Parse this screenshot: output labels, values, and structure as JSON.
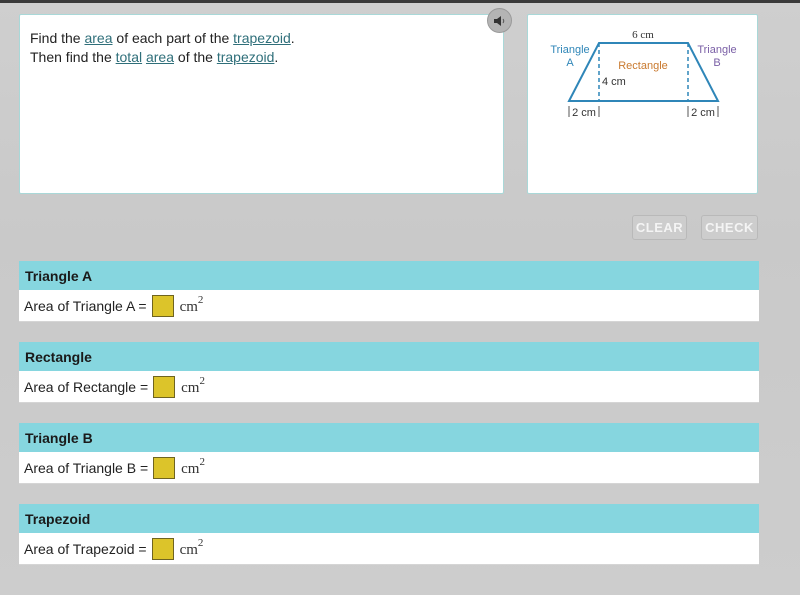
{
  "prompt": {
    "line1": {
      "t1": "Find the ",
      "link1": "area",
      "t2": " of each part of the ",
      "link2": "trapezoid",
      "t3": "."
    },
    "line2": {
      "t1": "Then find the ",
      "link1": "total",
      "t2": " ",
      "link2": "area",
      "t3": " of the ",
      "link3": "trapezoid",
      "t4": "."
    }
  },
  "audio": {
    "icon": "speaker-icon"
  },
  "figure": {
    "top_label": "6 cm",
    "triangle_a": [
      "Triangle",
      "A"
    ],
    "triangle_b": [
      "Triangle",
      "B"
    ],
    "rectangle": "Rectangle",
    "height": "4 cm",
    "left_base": "2 cm",
    "right_base": "2 cm",
    "colors": {
      "outline": "#2f86b8",
      "triangle_a": "#2f86b8",
      "triangle_b": "#7a5fa6",
      "rectangle": "#c97a2f"
    }
  },
  "buttons": {
    "clear": "CLEAR",
    "check": "CHECK"
  },
  "sections": [
    {
      "title": "Triangle A",
      "label": "Area of Triangle A =",
      "value": "",
      "unit": "cm",
      "exp": "2"
    },
    {
      "title": "Rectangle",
      "label": "Area of Rectangle =",
      "value": "",
      "unit": "cm",
      "exp": "2"
    },
    {
      "title": "Triangle B",
      "label": "Area of Triangle B =",
      "value": "",
      "unit": "cm",
      "exp": "2"
    },
    {
      "title": "Trapezoid",
      "label": "Area of Trapezoid =",
      "value": "",
      "unit": "cm",
      "exp": "2"
    }
  ]
}
